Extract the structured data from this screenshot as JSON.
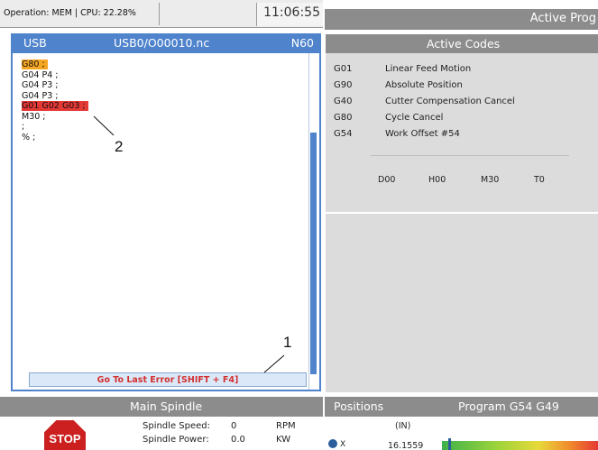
{
  "status": {
    "operation": "Operation: MEM | CPU: 22.28%",
    "time": "11:06:55"
  },
  "top_right": {
    "title": "Active Prog"
  },
  "program": {
    "device": "USB",
    "file": "USB0/O00010.nc",
    "sequence": "N60",
    "lines": [
      "G80 ;",
      "G04 P4 ;",
      "G04 P3 ;",
      "G04 P3 ;",
      "G01 G02 G03 ;",
      "M30 ;",
      ";",
      "% ;"
    ],
    "error_button": "Go To Last Error [SHIFT + F4]"
  },
  "callouts": [
    "1",
    "2"
  ],
  "active_codes": {
    "title": "Active Codes",
    "codes": [
      {
        "code": "G01",
        "desc": "Linear Feed Motion"
      },
      {
        "code": "G90",
        "desc": "Absolute Position"
      },
      {
        "code": "G40",
        "desc": "Cutter Compensation Cancel"
      },
      {
        "code": "G80",
        "desc": "Cycle Cancel"
      },
      {
        "code": "G54",
        "desc": "Work Offset #54"
      }
    ],
    "values": [
      "D00",
      "H00",
      "M30",
      "T0"
    ]
  },
  "spindle": {
    "title": "Main Spindle",
    "stop_label": "STOP",
    "speed_label": "Spindle Speed:",
    "speed_value": "0",
    "speed_unit": "RPM",
    "power_label": "Spindle Power:",
    "power_value": "0.0",
    "power_unit": "KW"
  },
  "positions": {
    "title": "Positions",
    "mode": "Program G54 G49",
    "unit": "(IN)",
    "axis": "X",
    "value": "16.1559"
  },
  "colors": {
    "program_blue": "#4f83cc",
    "header_gray": "#8c8c8c",
    "highlight_orange": "#f5a623",
    "error_red": "#e53935",
    "stop_red": "#cc1f1f"
  },
  "icons": {
    "stop": "stop-sign-icon",
    "axis": "axis-home-icon"
  }
}
